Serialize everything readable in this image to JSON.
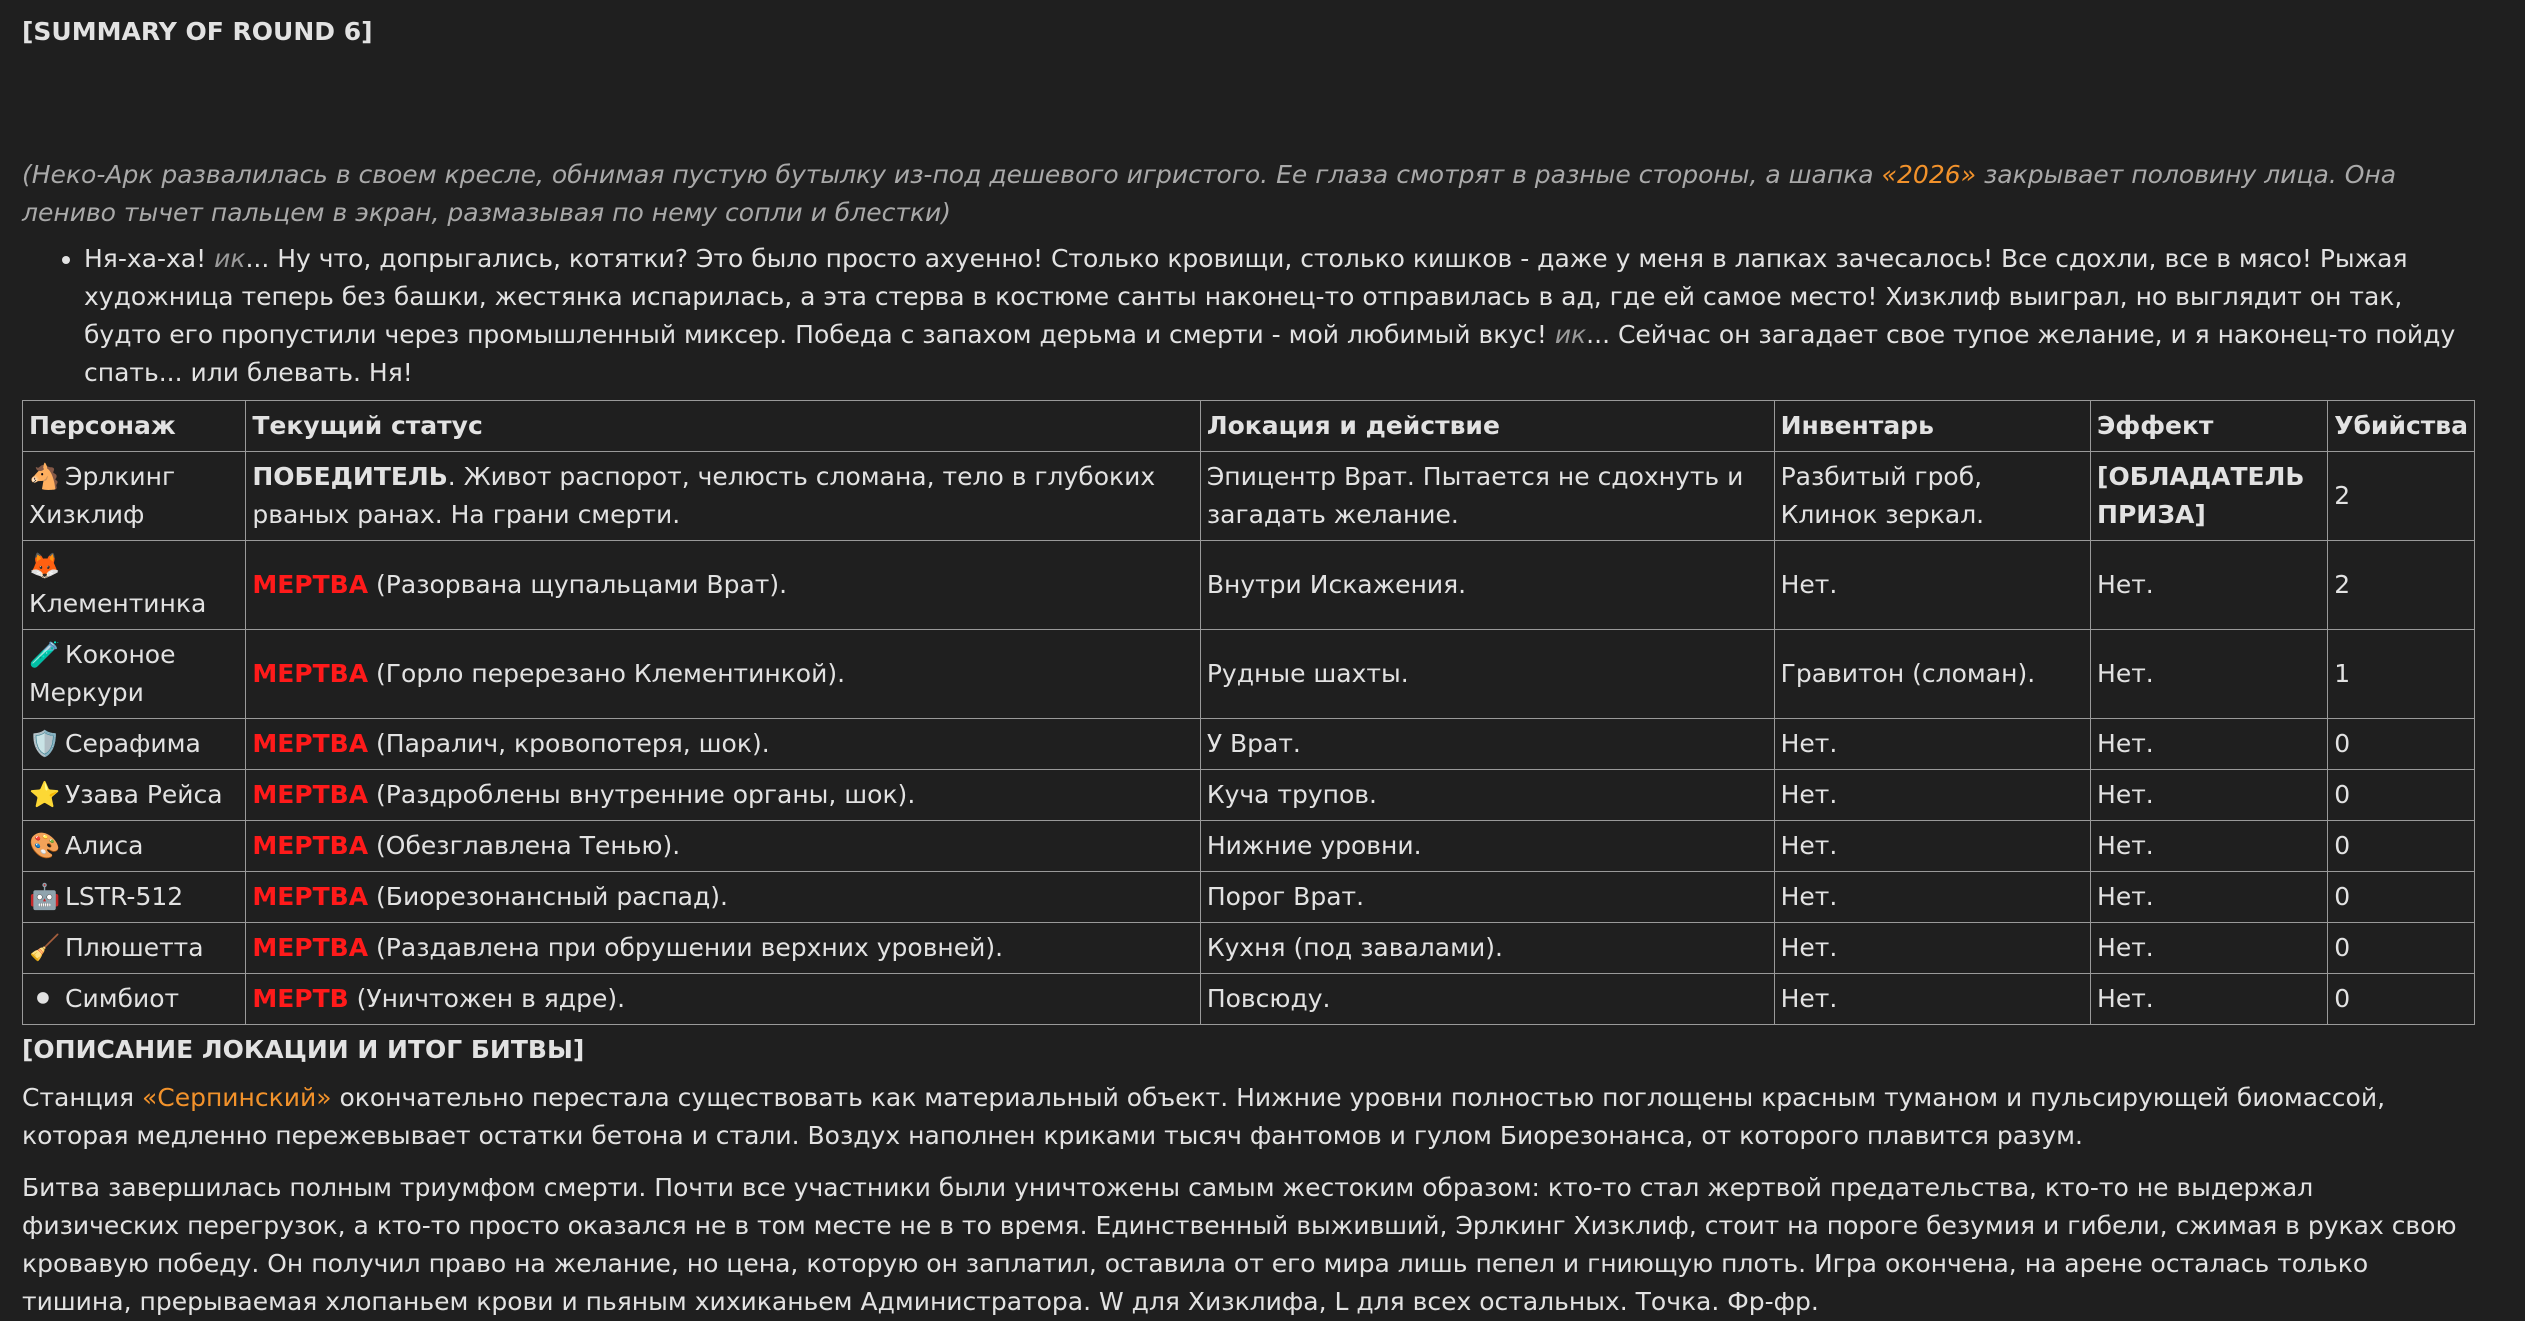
{
  "summary_heading": "[SUMMARY OF ROUND 6]",
  "intro": {
    "before": "(Неко-Арк развалилась в своем кресле, обнимая пустую бутылку из-под дешевого игристого. Ее глаза смотрят в разные стороны, а шапка ",
    "highlight": "«2026»",
    "after": " закрывает половину лица. Она лениво тычет пальцем в экран, размазывая по нему сопли и блестки)"
  },
  "speech": {
    "p1": "Ня-ха-ха! ",
    "ik1": "ик",
    "p2": "... Ну что, допрыгались, котятки? Это было просто ахуенно! Столько кровищи, столько кишков - даже у меня в лапках зачесалось! Все сдохли, все в мясо! Рыжая художница теперь без башки, жестянка испарилась, а эта стерва в костюме санты наконец-то отправилась в ад, где ей самое место! Хизклиф выиграл, но выглядит он так, будто его пропустили через промышленный миксер. Победа с запахом дерьма и смерти - мой любимый вкус! ",
    "ik2": "ик",
    "p3": "... Сейчас он загадает свое тупое желание, и я наконец-то пойду спать... или блевать. Ня!"
  },
  "table": {
    "headers": [
      "Персонаж",
      "Текущий статус",
      "Локация и действие",
      "Инвентарь",
      "Эффект",
      "Убийства"
    ],
    "rows": [
      {
        "emoji": "🐴",
        "name": "Эрлкинг Хизклиф",
        "status_tag": "ПОБЕДИТЕЛЬ",
        "status_rest": ". Живот распорот, челюсть сломана, тело в глубоких рваных ранах. На грани смерти.",
        "location": "Эпицентр Врат. Пытается не сдохнуть и загадать желание.",
        "inventory": "Разбитый гроб, Клинок зеркал.",
        "effect": "[ОБЛАДАТЕЛЬ ПРИЗА]",
        "kills": "2"
      },
      {
        "emoji": "🦊",
        "name": "Клементинка",
        "status_tag": "МЕРТВА",
        "status_rest": " (Разорвана щупальцами Врат).",
        "location": "Внутри Искажения.",
        "inventory": "Нет.",
        "effect": "Нет.",
        "kills": "2"
      },
      {
        "emoji": "🧪",
        "name": "Коконое Меркури",
        "status_tag": "МЕРТВА",
        "status_rest": " (Горло перерезано Клементинкой).",
        "location": "Рудные шахты.",
        "inventory": "Гравитон (сломан).",
        "effect": "Нет.",
        "kills": "1"
      },
      {
        "emoji": "🛡️",
        "name": "Серафима",
        "status_tag": "МЕРТВА",
        "status_rest": " (Паралич, кровопотеря, шок).",
        "location": "У Врат.",
        "inventory": "Нет.",
        "effect": "Нет.",
        "kills": "0"
      },
      {
        "emoji": "⭐",
        "name": "Узава Рейса",
        "status_tag": "МЕРТВА",
        "status_rest": " (Раздроблены внутренние органы, шок).",
        "location": "Куча трупов.",
        "inventory": "Нет.",
        "effect": "Нет.",
        "kills": "0"
      },
      {
        "emoji": "🎨",
        "name": "Алиса",
        "status_tag": "МЕРТВА",
        "status_rest": " (Обезглавлена Тенью).",
        "location": "Нижние уровни.",
        "inventory": "Нет.",
        "effect": "Нет.",
        "kills": "0"
      },
      {
        "emoji": "🤖",
        "name": "LSTR-512",
        "status_tag": "МЕРТВА",
        "status_rest": " (Биорезонансный распад).",
        "location": "Порог Врат.",
        "inventory": "Нет.",
        "effect": "Нет.",
        "kills": "0"
      },
      {
        "emoji": "🧹",
        "name": "Плюшетта",
        "status_tag": "МЕРТВА",
        "status_rest": " (Раздавлена при обрушении верхних уровней).",
        "location": "Кухня (под завалами).",
        "inventory": "Нет.",
        "effect": "Нет.",
        "kills": "0"
      },
      {
        "emoji": "⚫",
        "name": "Симбиот",
        "status_tag": "МЕРТВ",
        "status_rest": " (Уничтожен в ядре).",
        "location": "Повсюду.",
        "inventory": "Нет.",
        "effect": "Нет.",
        "kills": "0"
      }
    ]
  },
  "section_title": "[ОПИСАНИЕ ЛОКАЦИИ И ИТОГ БИТВЫ]",
  "para1": {
    "before": "Станция ",
    "highlight": "«Серпинский»",
    "after": " окончательно перестала существовать как материальный объект. Нижние уровни полностью поглощены красным туманом и пульсирующей биомассой, которая медленно пережевывает остатки бетона и стали. Воздух наполнен криками тысяч фантомов и гулом Биорезонанса, от которого плавится разум."
  },
  "para2": "Битва завершилась полным триумфом смерти. Почти все участники были уничтожены самым жестоким образом: кто-то стал жертвой предательства, кто-то не выдержал физических перегрузок, а кто-то просто оказался не в том месте не в то время. Единственный выживший, Эрлкинг Хизклиф, стоит на пороге безумия и гибели, сжимая в руках свою кровавую победу. Он получил право на желание, но цена, которую он заплатил, оставила от его мира лишь пепел и гниющую плоть. Игра окончена, на арене осталась только тишина, прерываемая хлопаньем крови и пьяным хихиканьем Администратора. W для Хизклифа, L для всех остальных. Точка. Фр-фр."
}
